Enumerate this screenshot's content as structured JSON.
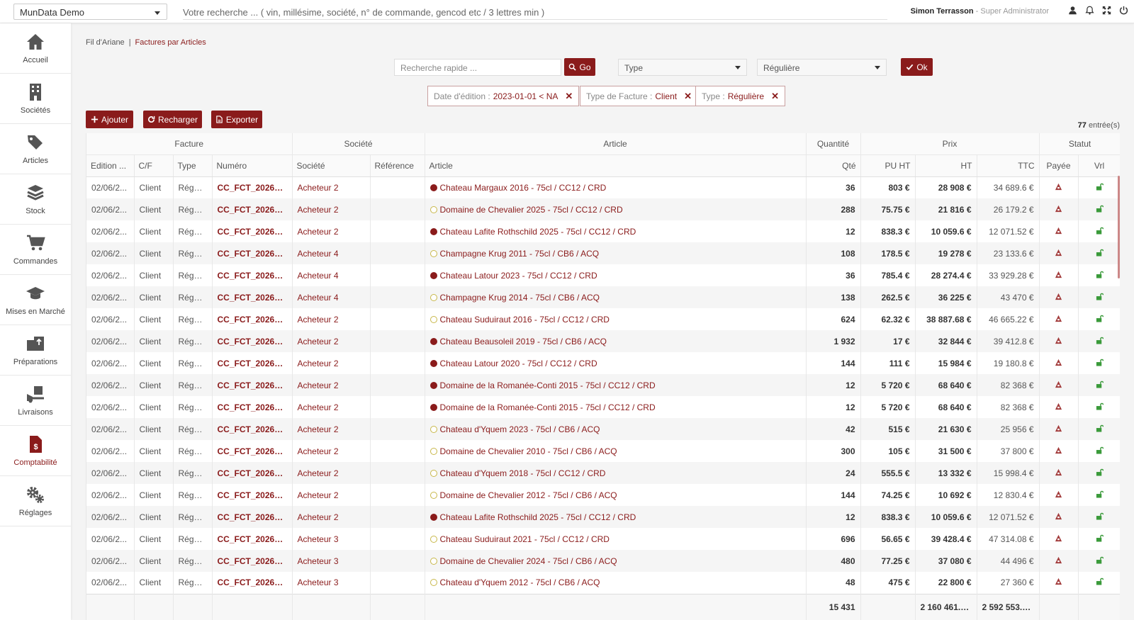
{
  "topbar": {
    "company": "MunData Demo",
    "search_placeholder": "Votre recherche ... ( vin, millésime, société, n° de commande, gencod etc / 3 lettres min )",
    "user_name": "Simon Terrasson",
    "user_role": "- Super Administrator"
  },
  "sidebar": {
    "items": [
      {
        "label": "Accueil",
        "icon": "home-icon"
      },
      {
        "label": "Sociétés",
        "icon": "building-icon"
      },
      {
        "label": "Articles",
        "icon": "tags-icon"
      },
      {
        "label": "Stock",
        "icon": "layers-icon"
      },
      {
        "label": "Commandes",
        "icon": "cart-icon"
      },
      {
        "label": "Mises en Marché",
        "icon": "graduation-cap-icon"
      },
      {
        "label": "Préparations",
        "icon": "dolly-icon"
      },
      {
        "label": "Livraisons",
        "icon": "truck-loading-icon"
      },
      {
        "label": "Comptabilité",
        "icon": "invoice-dollar-icon"
      },
      {
        "label": "Réglages",
        "icon": "cogs-icon"
      }
    ],
    "active": "Comptabilité"
  },
  "breadcrumb": {
    "root": "Fil d'Ariane",
    "separator": "|",
    "current": "Factures par Articles"
  },
  "filters": {
    "quick_search_placeholder": "Recherche rapide ...",
    "go_label": "Go",
    "type_select": "Type",
    "value_select": "Régulière",
    "ok_label": "Ok",
    "chips": [
      {
        "key": "Date d'édition :",
        "value": "2023-01-01 < NA"
      },
      {
        "key": "Type de Facture :",
        "value": "Client"
      },
      {
        "key": "Type :",
        "value": "Régulière"
      }
    ]
  },
  "actions": {
    "add": "Ajouter",
    "reload": "Recharger",
    "export": "Exporter"
  },
  "entries": {
    "count": "77",
    "label": "entrée(s)"
  },
  "table": {
    "groups": [
      "Facture",
      "Société",
      "Article",
      "Quantité",
      "Prix",
      "Statut"
    ],
    "columns": [
      "Edition ...",
      "C/F",
      "Type",
      "Numéro",
      "Société",
      "Référence",
      "Article",
      "Qté",
      "PU HT",
      "HT",
      "TTC",
      "Payée",
      "Vrl"
    ],
    "rows": [
      {
        "date": "02/06/2...",
        "cf": "Client",
        "type": "Réguli...",
        "num": "CC_FCT_202606/...",
        "soc": "Acheteur 2",
        "ref": "",
        "dot": "red",
        "article": "Chateau Margaux 2016 - 75cl / CC12 / CRD",
        "qte": "36",
        "pu": "803 €",
        "ht": "28 908 €",
        "ttc": "34 689.6 €"
      },
      {
        "date": "02/06/2...",
        "cf": "Client",
        "type": "Réguli...",
        "num": "CC_FCT_202606/...",
        "soc": "Acheteur 2",
        "ref": "",
        "dot": "white",
        "article": "Domaine de Chevalier 2025 - 75cl / CC12 / CRD",
        "qte": "288",
        "pu": "75.75 €",
        "ht": "21 816 €",
        "ttc": "26 179.2 €"
      },
      {
        "date": "02/06/2...",
        "cf": "Client",
        "type": "Réguli...",
        "num": "CC_FCT_202606/...",
        "soc": "Acheteur 2",
        "ref": "",
        "dot": "red",
        "article": "Chateau Lafite Rothschild 2025 - 75cl / CC12 / CRD",
        "qte": "12",
        "pu": "838.3 €",
        "ht": "10 059.6 €",
        "ttc": "12 071.52 €"
      },
      {
        "date": "02/06/2...",
        "cf": "Client",
        "type": "Réguli...",
        "num": "CC_FCT_202606/...",
        "soc": "Acheteur 4",
        "ref": "",
        "dot": "white",
        "article": "Champagne Krug 2011 - 75cl / CB6 / ACQ",
        "qte": "108",
        "pu": "178.5 €",
        "ht": "19 278 €",
        "ttc": "23 133.6 €"
      },
      {
        "date": "02/06/2...",
        "cf": "Client",
        "type": "Réguli...",
        "num": "CC_FCT_202606/...",
        "soc": "Acheteur 4",
        "ref": "",
        "dot": "red",
        "article": "Chateau Latour 2023 - 75cl / CC12 / CRD",
        "qte": "36",
        "pu": "785.4 €",
        "ht": "28 274.4 €",
        "ttc": "33 929.28 €"
      },
      {
        "date": "02/06/2...",
        "cf": "Client",
        "type": "Réguli...",
        "num": "CC_FCT_202606/...",
        "soc": "Acheteur 4",
        "ref": "",
        "dot": "white",
        "article": "Champagne Krug 2014 - 75cl / CB6 / ACQ",
        "qte": "138",
        "pu": "262.5 €",
        "ht": "36 225 €",
        "ttc": "43 470 €"
      },
      {
        "date": "02/06/2...",
        "cf": "Client",
        "type": "Réguli...",
        "num": "CC_FCT_202606/...",
        "soc": "Acheteur 2",
        "ref": "",
        "dot": "white",
        "article": "Chateau Suduiraut 2016 - 75cl / CC12 / CRD",
        "qte": "624",
        "pu": "62.32 €",
        "ht": "38 887.68 €",
        "ttc": "46 665.22 €"
      },
      {
        "date": "02/06/2...",
        "cf": "Client",
        "type": "Réguli...",
        "num": "CC_FCT_202606/...",
        "soc": "Acheteur 2",
        "ref": "",
        "dot": "red",
        "article": "Chateau Beausoleil 2019 - 75cl / CB6 / ACQ",
        "qte": "1 932",
        "pu": "17 €",
        "ht": "32 844 €",
        "ttc": "39 412.8 €"
      },
      {
        "date": "02/06/2...",
        "cf": "Client",
        "type": "Réguli...",
        "num": "CC_FCT_202606/...",
        "soc": "Acheteur 2",
        "ref": "",
        "dot": "red",
        "article": "Chateau Latour 2020 - 75cl / CC12 / CRD",
        "qte": "144",
        "pu": "111 €",
        "ht": "15 984 €",
        "ttc": "19 180.8 €"
      },
      {
        "date": "02/06/2...",
        "cf": "Client",
        "type": "Réguli...",
        "num": "CC_FCT_202606/...",
        "soc": "Acheteur 2",
        "ref": "",
        "dot": "red",
        "article": "Domaine de la Romanée-Conti 2015 - 75cl / CC12 / CRD",
        "qte": "12",
        "pu": "5 720 €",
        "ht": "68 640 €",
        "ttc": "82 368 €"
      },
      {
        "date": "02/06/2...",
        "cf": "Client",
        "type": "Réguli...",
        "num": "CC_FCT_202606/...",
        "soc": "Acheteur 2",
        "ref": "",
        "dot": "red",
        "article": "Domaine de la Romanée-Conti 2015 - 75cl / CC12 / CRD",
        "qte": "12",
        "pu": "5 720 €",
        "ht": "68 640 €",
        "ttc": "82 368 €"
      },
      {
        "date": "02/06/2...",
        "cf": "Client",
        "type": "Réguli...",
        "num": "CC_FCT_202606/...",
        "soc": "Acheteur 2",
        "ref": "",
        "dot": "white",
        "article": "Chateau d'Yquem 2023 - 75cl / CB6 / ACQ",
        "qte": "42",
        "pu": "515 €",
        "ht": "21 630 €",
        "ttc": "25 956 €"
      },
      {
        "date": "02/06/2...",
        "cf": "Client",
        "type": "Réguli...",
        "num": "CC_FCT_202606/...",
        "soc": "Acheteur 2",
        "ref": "",
        "dot": "white",
        "article": "Domaine de Chevalier 2010 - 75cl / CB6 / ACQ",
        "qte": "300",
        "pu": "105 €",
        "ht": "31 500 €",
        "ttc": "37 800 €"
      },
      {
        "date": "02/06/2...",
        "cf": "Client",
        "type": "Réguli...",
        "num": "CC_FCT_202606/...",
        "soc": "Acheteur 2",
        "ref": "",
        "dot": "white",
        "article": "Chateau d'Yquem 2018 - 75cl / CC12 / CRD",
        "qte": "24",
        "pu": "555.5 €",
        "ht": "13 332 €",
        "ttc": "15 998.4 €"
      },
      {
        "date": "02/06/2...",
        "cf": "Client",
        "type": "Réguli...",
        "num": "CC_FCT_202606/...",
        "soc": "Acheteur 2",
        "ref": "",
        "dot": "white",
        "article": "Domaine de Chevalier 2012 - 75cl / CB6 / ACQ",
        "qte": "144",
        "pu": "74.25 €",
        "ht": "10 692 €",
        "ttc": "12 830.4 €"
      },
      {
        "date": "02/06/2...",
        "cf": "Client",
        "type": "Réguli...",
        "num": "CC_FCT_202606/...",
        "soc": "Acheteur 2",
        "ref": "",
        "dot": "red",
        "article": "Chateau Lafite Rothschild 2025 - 75cl / CC12 / CRD",
        "qte": "12",
        "pu": "838.3 €",
        "ht": "10 059.6 €",
        "ttc": "12 071.52 €"
      },
      {
        "date": "02/06/2...",
        "cf": "Client",
        "type": "Réguli...",
        "num": "CC_FCT_202606/...",
        "soc": "Acheteur 3",
        "ref": "",
        "dot": "white",
        "article": "Chateau Suduiraut 2021 - 75cl / CC12 / CRD",
        "qte": "696",
        "pu": "56.65 €",
        "ht": "39 428.4 €",
        "ttc": "47 314.08 €"
      },
      {
        "date": "02/06/2...",
        "cf": "Client",
        "type": "Réguli...",
        "num": "CC_FCT_202606/...",
        "soc": "Acheteur 3",
        "ref": "",
        "dot": "white",
        "article": "Domaine de Chevalier 2024 - 75cl / CB6 / ACQ",
        "qte": "480",
        "pu": "77.25 €",
        "ht": "37 080 €",
        "ttc": "44 496 €"
      },
      {
        "date": "02/06/2...",
        "cf": "Client",
        "type": "Réguli...",
        "num": "CC_FCT_202606/...",
        "soc": "Acheteur 3",
        "ref": "",
        "dot": "white",
        "article": "Chateau d'Yquem 2012 - 75cl / CB6 / ACQ",
        "qte": "48",
        "pu": "475 €",
        "ht": "22 800 €",
        "ttc": "27 360 €"
      }
    ],
    "totals": {
      "qte": "15 431",
      "ht": "2 160 461.6...",
      "ttc": "2 592 553.9..."
    }
  },
  "colors": {
    "accent": "#8a1b1b",
    "paid_icon": "#a23b3b",
    "delivered_icon": "#3a9a3a"
  }
}
